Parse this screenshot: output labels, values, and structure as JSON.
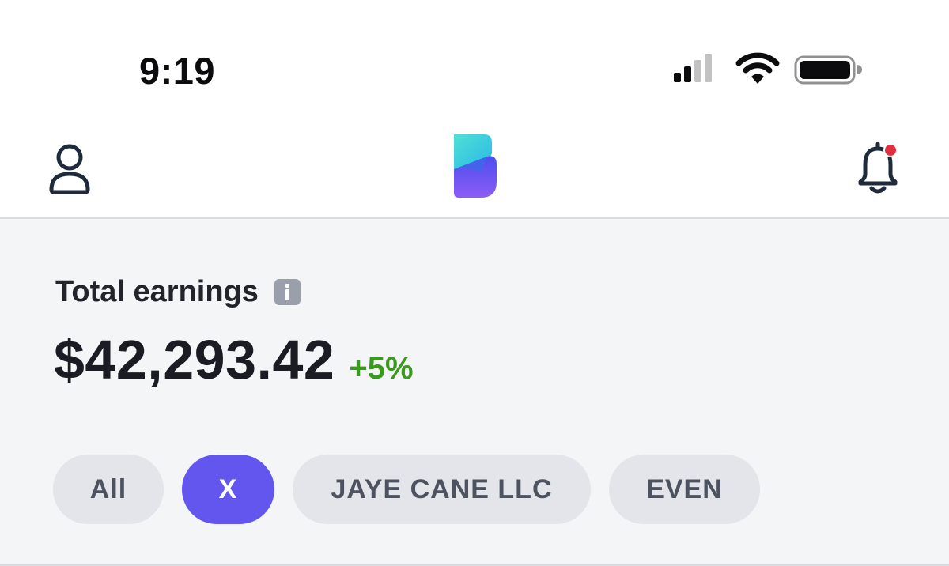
{
  "status_bar": {
    "time": "9:19",
    "icons": [
      "cellular-signal-icon",
      "wifi-icon",
      "battery-icon"
    ]
  },
  "header": {
    "left_icon": "user-profile-icon",
    "logo": "app-logo",
    "right_icon": "bell-icon",
    "notification_dot_color": "#e0303e"
  },
  "earnings": {
    "label": "Total earnings",
    "info_icon": "info-icon",
    "amount": "$42,293.42",
    "change": "+5%",
    "change_color": "#3a9a1c"
  },
  "filters": {
    "selected": "X",
    "accent_color": "#6256ee",
    "chips": [
      {
        "label": "All"
      },
      {
        "label": "X"
      },
      {
        "label": "JAYE CANE LLC"
      },
      {
        "label": "EVEN"
      }
    ]
  }
}
